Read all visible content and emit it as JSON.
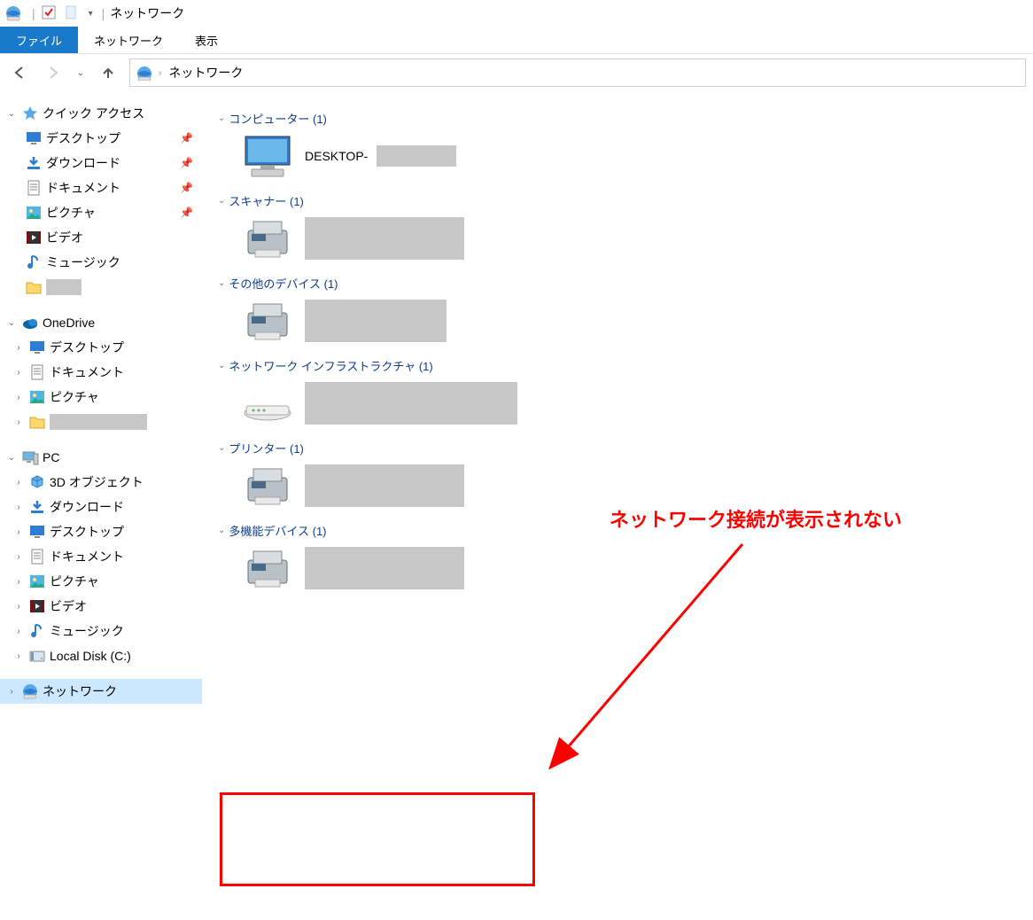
{
  "title_bar": {
    "app_title": "ネットワーク"
  },
  "ribbon": {
    "file_tab": "ファイル",
    "network_tab": "ネットワーク",
    "view_tab": "表示"
  },
  "address_bar": {
    "location": "ネットワーク"
  },
  "sidebar": {
    "quick_access": {
      "label": "クイック アクセス",
      "items": [
        {
          "label": "デスクトップ",
          "pinned": true,
          "icon": "desktop"
        },
        {
          "label": "ダウンロード",
          "pinned": true,
          "icon": "download"
        },
        {
          "label": "ドキュメント",
          "pinned": true,
          "icon": "document"
        },
        {
          "label": "ピクチャ",
          "pinned": true,
          "icon": "picture"
        },
        {
          "label": "ビデオ",
          "pinned": false,
          "icon": "video"
        },
        {
          "label": "ミュージック",
          "pinned": false,
          "icon": "music"
        },
        {
          "label": "",
          "pinned": false,
          "icon": "folder",
          "redacted": true
        }
      ]
    },
    "onedrive": {
      "label": "OneDrive",
      "items": [
        {
          "label": "デスクトップ",
          "icon": "desktop"
        },
        {
          "label": "ドキュメント",
          "icon": "document"
        },
        {
          "label": "ピクチャ",
          "icon": "picture"
        },
        {
          "label": "",
          "icon": "folder",
          "redacted": true
        }
      ]
    },
    "pc": {
      "label": "PC",
      "items": [
        {
          "label": "3D オブジェクト",
          "icon": "3d"
        },
        {
          "label": "ダウンロード",
          "icon": "download"
        },
        {
          "label": "デスクトップ",
          "icon": "desktop"
        },
        {
          "label": "ドキュメント",
          "icon": "document"
        },
        {
          "label": "ピクチャ",
          "icon": "picture"
        },
        {
          "label": "ビデオ",
          "icon": "video"
        },
        {
          "label": "ミュージック",
          "icon": "music"
        },
        {
          "label": "Local Disk (C:)",
          "icon": "disk"
        }
      ]
    },
    "network": {
      "label": "ネットワーク"
    }
  },
  "groups": {
    "computer": {
      "header": "コンピューター (1)",
      "item_label": "DESKTOP-"
    },
    "scanner": {
      "header": "スキャナー (1)"
    },
    "other": {
      "header": "その他のデバイス (1)"
    },
    "infra": {
      "header": "ネットワーク インフラストラクチャ (1)"
    },
    "printer": {
      "header": "プリンター (1)"
    },
    "multi": {
      "header": "多機能デバイス (1)"
    }
  },
  "annotation": {
    "text": "ネットワーク接続が表示されない"
  }
}
